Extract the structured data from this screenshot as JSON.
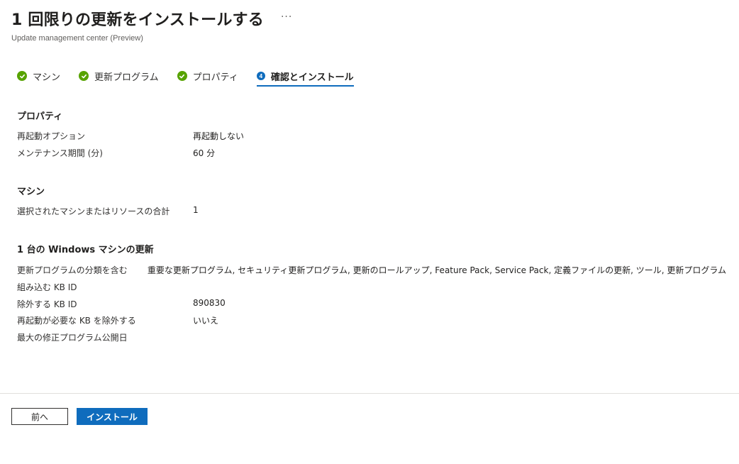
{
  "header": {
    "title": "1 回限りの更新をインストールする",
    "more_glyph": "···",
    "subtitle": "Update management center (Preview)"
  },
  "tabs": [
    {
      "label": "マシン",
      "state": "complete",
      "icon": "check-circle-icon"
    },
    {
      "label": "更新プログラム",
      "state": "complete",
      "icon": "check-circle-icon"
    },
    {
      "label": "プロパティ",
      "state": "complete",
      "icon": "check-circle-icon"
    },
    {
      "label": "確認とインストール",
      "state": "active",
      "step": "4",
      "icon": "step-number-icon"
    }
  ],
  "sections": {
    "properties": {
      "title": "プロパティ",
      "rows": [
        {
          "key": "再起動オプション",
          "value": "再起動しない"
        },
        {
          "key": "メンテナンス期間 (分)",
          "value": "60 分"
        }
      ]
    },
    "machines": {
      "title": "マシン",
      "rows": [
        {
          "key": "選択されたマシンまたはリソースの合計",
          "value": "1"
        }
      ]
    },
    "windows": {
      "title": "1 台の Windows マシンの更新",
      "rows": [
        {
          "key": "更新プログラムの分類を含む",
          "value": "重要な更新プログラム, セキュリティ更新プログラム, 更新のロールアップ, Feature Pack, Service Pack, 定義ファイルの更新, ツール, 更新プログラム"
        },
        {
          "key": "組み込む KB ID",
          "value": ""
        },
        {
          "key": "除外する KB ID",
          "value": "890830"
        },
        {
          "key": "再起動が必要な KB を除外する",
          "value": "いいえ"
        },
        {
          "key": "最大の修正プログラム公開日",
          "value": ""
        }
      ]
    }
  },
  "footer": {
    "prev_label": "前へ",
    "install_label": "インストール"
  },
  "colors": {
    "accent": "#0f6cbd",
    "success": "#57a300",
    "text": "#323130"
  }
}
